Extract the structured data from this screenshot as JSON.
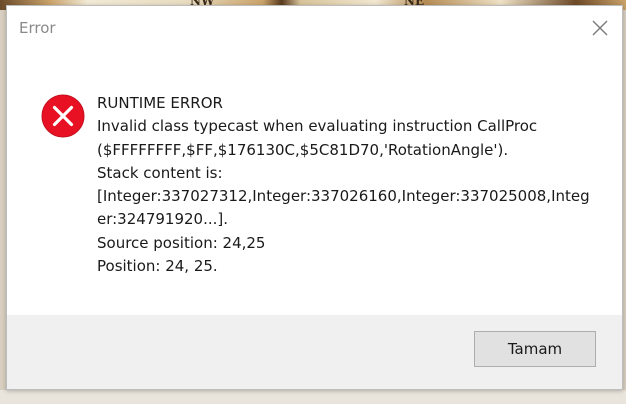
{
  "background": {
    "fragments": [
      "NW",
      "NE"
    ]
  },
  "dialog": {
    "title": "Error",
    "close_icon": "close-icon",
    "icon": "error-circle-x-icon",
    "accent_color": "#e81123",
    "message_lines": [
      "RUNTIME ERROR",
      "Invalid class typecast when evaluating instruction CallProc",
      "($FFFFFFFF,$FF,$176130C,$5C81D70,'RotationAngle').",
      "Stack content is:",
      "[Integer:337027312,Integer:337026160,Integer:337025008,Integ",
      "er:324791920...].",
      "Source position: 24,25",
      "Position: 24, 25."
    ],
    "ok_label": "Tamam"
  }
}
